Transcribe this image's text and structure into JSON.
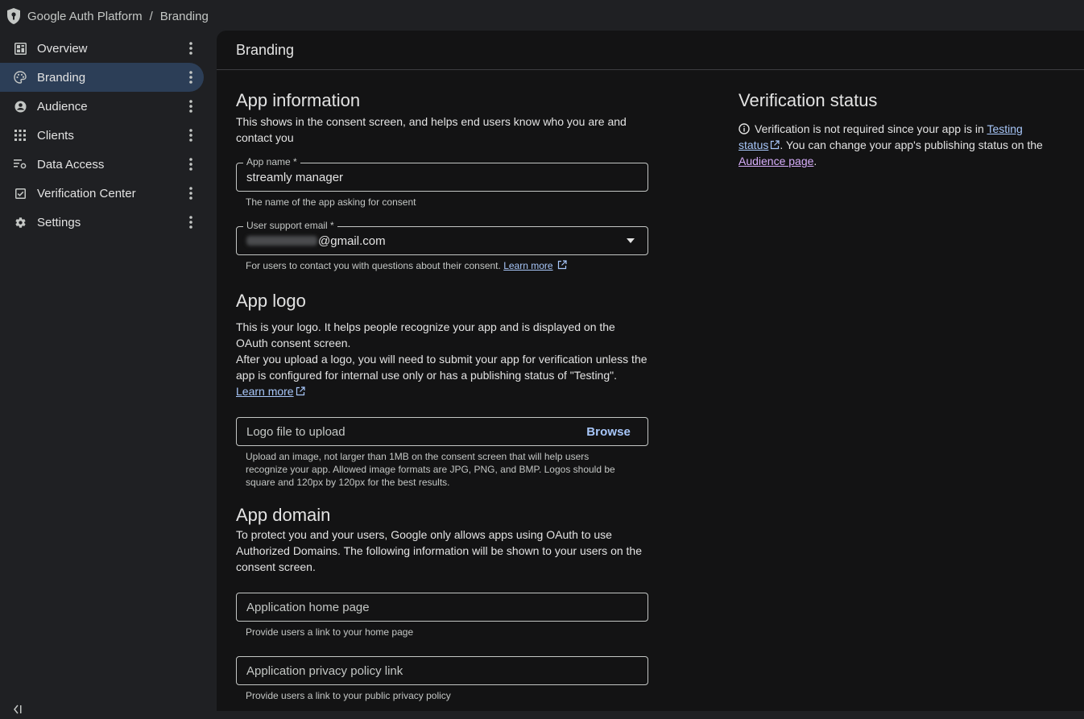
{
  "breadcrumb": {
    "app": "Google Auth Platform",
    "separator": "/",
    "current": "Branding"
  },
  "sidebar": {
    "items": [
      {
        "label": "Overview",
        "icon": "dashboard-icon",
        "active": false
      },
      {
        "label": "Branding",
        "icon": "palette-icon",
        "active": true
      },
      {
        "label": "Audience",
        "icon": "account-circle-icon",
        "active": false
      },
      {
        "label": "Clients",
        "icon": "apps-grid-icon",
        "active": false
      },
      {
        "label": "Data Access",
        "icon": "data-filter-icon",
        "active": false
      },
      {
        "label": "Verification Center",
        "icon": "checkbox-icon",
        "active": false
      },
      {
        "label": "Settings",
        "icon": "gear-icon",
        "active": false
      }
    ]
  },
  "main": {
    "title": "Branding",
    "app_info": {
      "heading": "App information",
      "description": "This shows in the consent screen, and helps end users know who you are and contact you",
      "app_name_label": "App name *",
      "app_name_value": "streamly manager",
      "app_name_hint": "The name of the app asking for consent",
      "support_email_label": "User support email *",
      "support_email_value": "@gmail.com",
      "support_email_hint": "For users to contact you with questions about their consent.",
      "learn_more": "Learn more"
    },
    "app_logo": {
      "heading": "App logo",
      "description_1": "This is your logo. It helps people recognize your app and is displayed on the OAuth consent screen.",
      "description_2": "After you upload a logo, you will need to submit your app for verification unless the app is configured for internal use only or has a publishing status of \"Testing\".",
      "learn_more": "Learn more",
      "upload_placeholder": "Logo file to upload",
      "browse_label": "Browse",
      "upload_hint": "Upload an image, not larger than 1MB on the consent screen that will help users recognize your app. Allowed image formats are JPG, PNG, and BMP. Logos should be square and 120px by 120px for the best results."
    },
    "app_domain": {
      "heading": "App domain",
      "description": "To protect you and your users, Google only allows apps using OAuth to use Authorized Domains. The following information will be shown to your users on the consent screen.",
      "home_page_placeholder": "Application home page",
      "home_page_hint": "Provide users a link to your home page",
      "privacy_placeholder": "Application privacy policy link",
      "privacy_hint": "Provide users a link to your public privacy policy"
    },
    "verification": {
      "heading": "Verification status",
      "text_1": "Verification is not required since your app is in",
      "link_testing": "Testing status",
      "text_2": ". You can change your app's publishing status on the",
      "link_audience": "Audience page",
      "text_3": "."
    }
  },
  "colors": {
    "accent": "#a8c7fa",
    "visited_link": "#d7aefb",
    "active_nav": "#2c3e57",
    "background": "#131314",
    "sidebar_bg": "#1f2023"
  }
}
